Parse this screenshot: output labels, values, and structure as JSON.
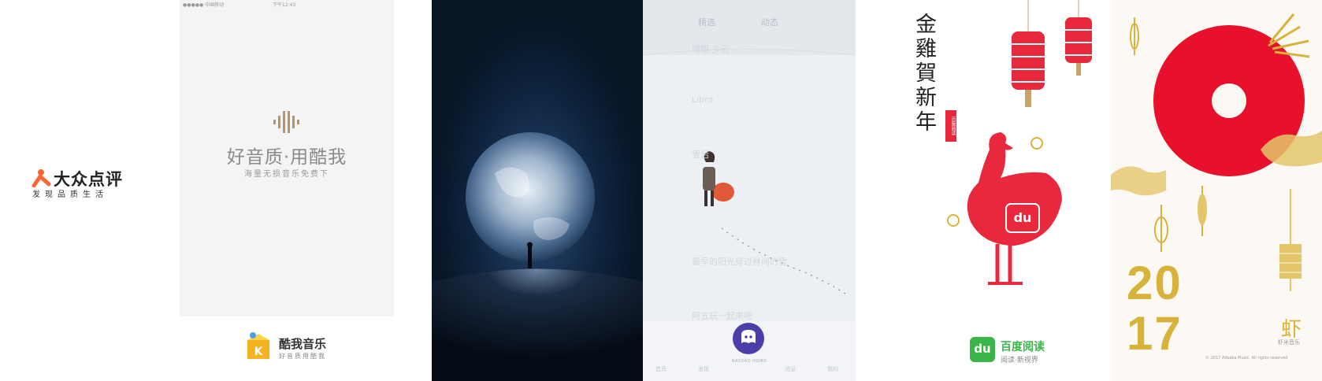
{
  "dianping": {
    "logo_text": "大众点评",
    "slogan": "发现品质生活",
    "accent": "#ff6633"
  },
  "kuwo": {
    "status_left": "●●●●● 中国移动",
    "status_time": "下午12:43",
    "tagline": "好音质·用酷我",
    "subtitle": "海量无损音乐免费下",
    "app_name": "酷我音乐",
    "app_sub": "好音质用酷我",
    "accent": "#b8936a"
  },
  "earth_splash": {
    "icon": "earth-moon-icon"
  },
  "snow_app": {
    "tabs": [
      "精选",
      "动态"
    ],
    "rows": [
      "晴朗·多云",
      "Libra",
      "雪后",
      "最早的阳光穿过林间的雪",
      "阿五玩一起来吧"
    ],
    "logo_label": "NASOAO HOMO",
    "nav": [
      "首页",
      "发现",
      "",
      "消息",
      "我的"
    ]
  },
  "baidu_read": {
    "greeting": "金雞賀新年",
    "stamp": "百度阅读",
    "rooster_badge": "du",
    "app_name": "百度阅读",
    "app_sub": "阅读·新视界",
    "green": "#3bb549",
    "red": "#e8283c"
  },
  "xiami": {
    "year_top": "20",
    "year_bottom": "17",
    "brand": "虾",
    "brand_sub": "虾米音乐",
    "copyright": "© 2017 Alibaba Music. All rights reserved",
    "red": "#e8102a",
    "gold": "#d8b33c"
  }
}
